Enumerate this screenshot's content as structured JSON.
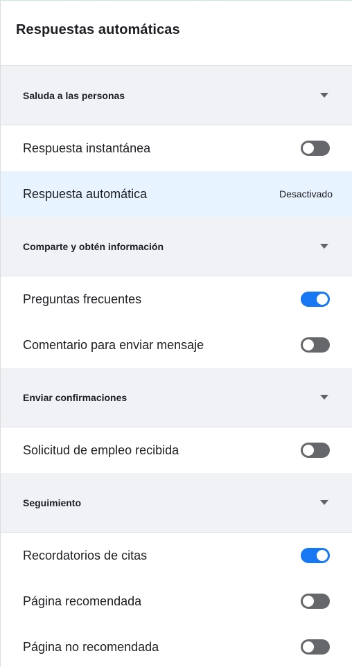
{
  "title": "Respuestas automáticas",
  "colors": {
    "accent": "#1877f2",
    "toggle_off": "#65676b",
    "section_bg": "#f0f2f5",
    "highlight_bg": "#e7f3ff"
  },
  "sections": [
    {
      "label": "Saluda a las personas",
      "icon": "caret-down-icon",
      "items": [
        {
          "label": "Respuesta instantánea",
          "control": "toggle",
          "on": false
        },
        {
          "label": "Respuesta automática",
          "control": "status",
          "status": "Desactivado",
          "highlighted": true
        }
      ]
    },
    {
      "label": "Comparte y obtén información",
      "icon": "caret-down-icon",
      "items": [
        {
          "label": "Preguntas frecuentes",
          "control": "toggle",
          "on": true
        },
        {
          "label": "Comentario para enviar mensaje",
          "control": "toggle",
          "on": false
        }
      ]
    },
    {
      "label": "Enviar confirmaciones",
      "icon": "caret-down-icon",
      "items": [
        {
          "label": "Solicitud de empleo recibida",
          "control": "toggle",
          "on": false
        }
      ]
    },
    {
      "label": "Seguimiento",
      "icon": "caret-down-icon",
      "items": [
        {
          "label": "Recordatorios de citas",
          "control": "toggle",
          "on": true
        },
        {
          "label": "Página recomendada",
          "control": "toggle",
          "on": false
        },
        {
          "label": "Página no recomendada",
          "control": "toggle",
          "on": false
        }
      ]
    }
  ]
}
